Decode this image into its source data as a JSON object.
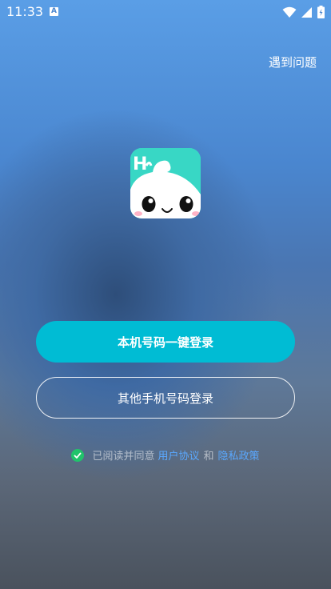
{
  "status_bar": {
    "time": "11:33",
    "notification_badge": "A"
  },
  "header": {
    "help_label": "遇到问题"
  },
  "login": {
    "one_click_label": "本机号码一键登录",
    "other_phone_label": "其他手机号码登录"
  },
  "agreement": {
    "prefix": "已阅读并同意",
    "user_agreement": "用户协议",
    "and": "和",
    "privacy_policy": "隐私政策"
  },
  "app_icon": {
    "letters": "H",
    "colors": {
      "background": "#38d7c5",
      "face": "#ffffff"
    }
  },
  "colors": {
    "primary_button": "#00bcd4",
    "link": "#5aa8ff",
    "check": "#21c36b"
  }
}
